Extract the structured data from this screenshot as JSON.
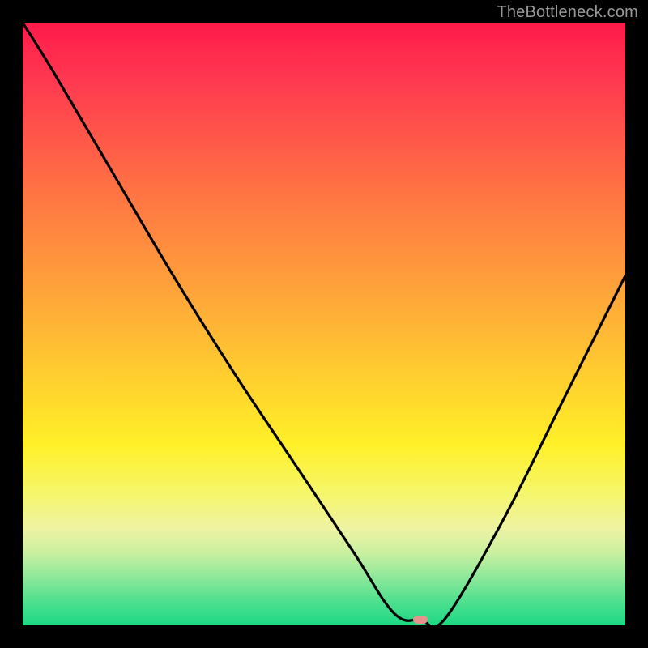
{
  "watermark": "TheBottleneck.com",
  "colors": {
    "frame": "#000000",
    "curve": "#000000",
    "marker": "#e6938e",
    "gradient_top": "#ff1a4b",
    "gradient_bottom": "#1dd884"
  },
  "chart_data": {
    "type": "line",
    "title": "",
    "xlabel": "",
    "ylabel": "",
    "xlim": [
      0,
      100
    ],
    "ylim": [
      0,
      100
    ],
    "x": [
      0,
      5,
      15,
      25,
      35,
      45,
      55,
      60,
      63,
      66,
      70,
      80,
      90,
      100
    ],
    "y": [
      100,
      92,
      75,
      58,
      42,
      27,
      12,
      4,
      1,
      1,
      1,
      18,
      38,
      58
    ],
    "marker": {
      "x": 66,
      "y": 1
    },
    "note": "Values are read from the plot in percent of axis range; y=0 at the bottom green strip, y=100 at the top red edge. Curve descends steeply from upper-left, flattens to a minimum near x≈63–70, then rises toward the right edge."
  }
}
